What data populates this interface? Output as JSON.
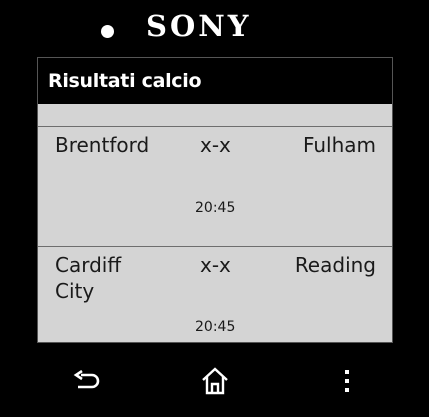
{
  "device": {
    "brand": "SONY"
  },
  "app": {
    "title": "Risultati calcio"
  },
  "matches": [
    {
      "home": "Brentford",
      "score": "x-x",
      "away": "Fulham",
      "time": "20:45"
    },
    {
      "home": "Cardiff City",
      "score": "x-x",
      "away": "Reading",
      "time": "20:45"
    }
  ],
  "nav": {
    "back_icon": "back-icon",
    "home_icon": "home-icon",
    "menu_icon": "more-vert-icon"
  },
  "colors": {
    "screen_bg": "#d4d4d4",
    "title_bar_bg": "#000000",
    "bezel": "#000000"
  }
}
